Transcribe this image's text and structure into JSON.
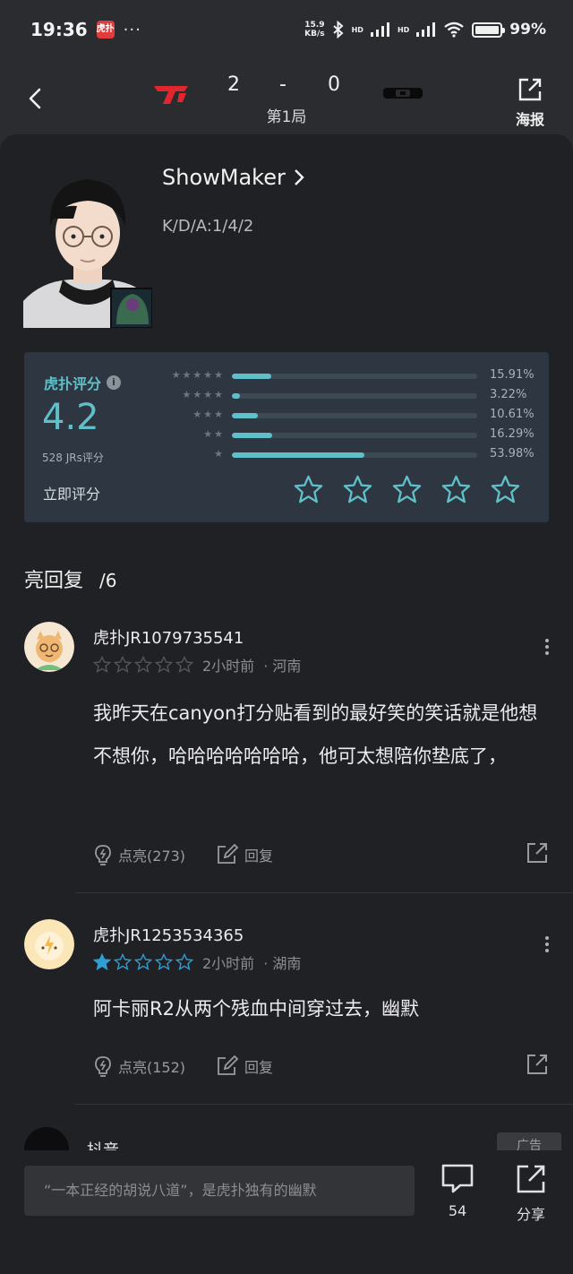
{
  "status_bar": {
    "time": "19:36",
    "app_badge": "虎扑",
    "dots": "···",
    "net_speed_top": "15.9",
    "net_speed_bottom": "KB/s",
    "hd1": "HD",
    "hd2": "HD",
    "battery": "99%"
  },
  "match": {
    "score_left": "2",
    "score_dash": "-",
    "score_right": "0",
    "game_label": "第1局",
    "poster_label": "海报"
  },
  "player": {
    "name": "ShowMaker",
    "kda": "K/D/A:1/4/2"
  },
  "rating": {
    "brand": "虎扑评分",
    "score": "4.2",
    "count": "528 JRs评分",
    "rate_now": "立即评分",
    "rating_value": 0,
    "distribution": [
      {
        "stars": "★★★★★",
        "pct_label": "15.91%",
        "pct": 15.91
      },
      {
        "stars": "★★★★",
        "pct_label": "3.22%",
        "pct": 3.22
      },
      {
        "stars": "★★★",
        "pct_label": "10.61%",
        "pct": 10.61
      },
      {
        "stars": "★★",
        "pct_label": "16.29%",
        "pct": 16.29
      },
      {
        "stars": "★",
        "pct_label": "53.98%",
        "pct": 53.98
      }
    ]
  },
  "replies": {
    "title": "亮回复",
    "count": "/6",
    "items": [
      {
        "user": "虎扑JR1079735541",
        "stars_filled": 0,
        "time": "2小时前",
        "location": "· 河南",
        "text": "我昨天在canyon打分贴看到的最好笑的笑话就是他想不想你，哈哈哈哈哈哈哈，他可太想陪你垫底了，",
        "like_label": "点亮(273)",
        "reply_label": "回复"
      },
      {
        "user": "虎扑JR1253534365",
        "stars_filled": 1,
        "time": "2小时前",
        "location": "· 湖南",
        "text": "阿卡丽R2从两个残血中间穿过去，幽默",
        "like_label": "点亮(152)",
        "reply_label": "回复"
      }
    ]
  },
  "ad": {
    "name": "抖音",
    "tag": "广告"
  },
  "bottom_bar": {
    "input_placeholder": "“一本正经的胡说八道”，是虎扑独有的幽默",
    "comment_count": "54",
    "share_label": "分享"
  },
  "colors": {
    "accent": "#5fc0c9",
    "background": "#202125",
    "header": "#2b2c30",
    "panel": "#2e3741",
    "star_active": "#2f9fd4"
  }
}
